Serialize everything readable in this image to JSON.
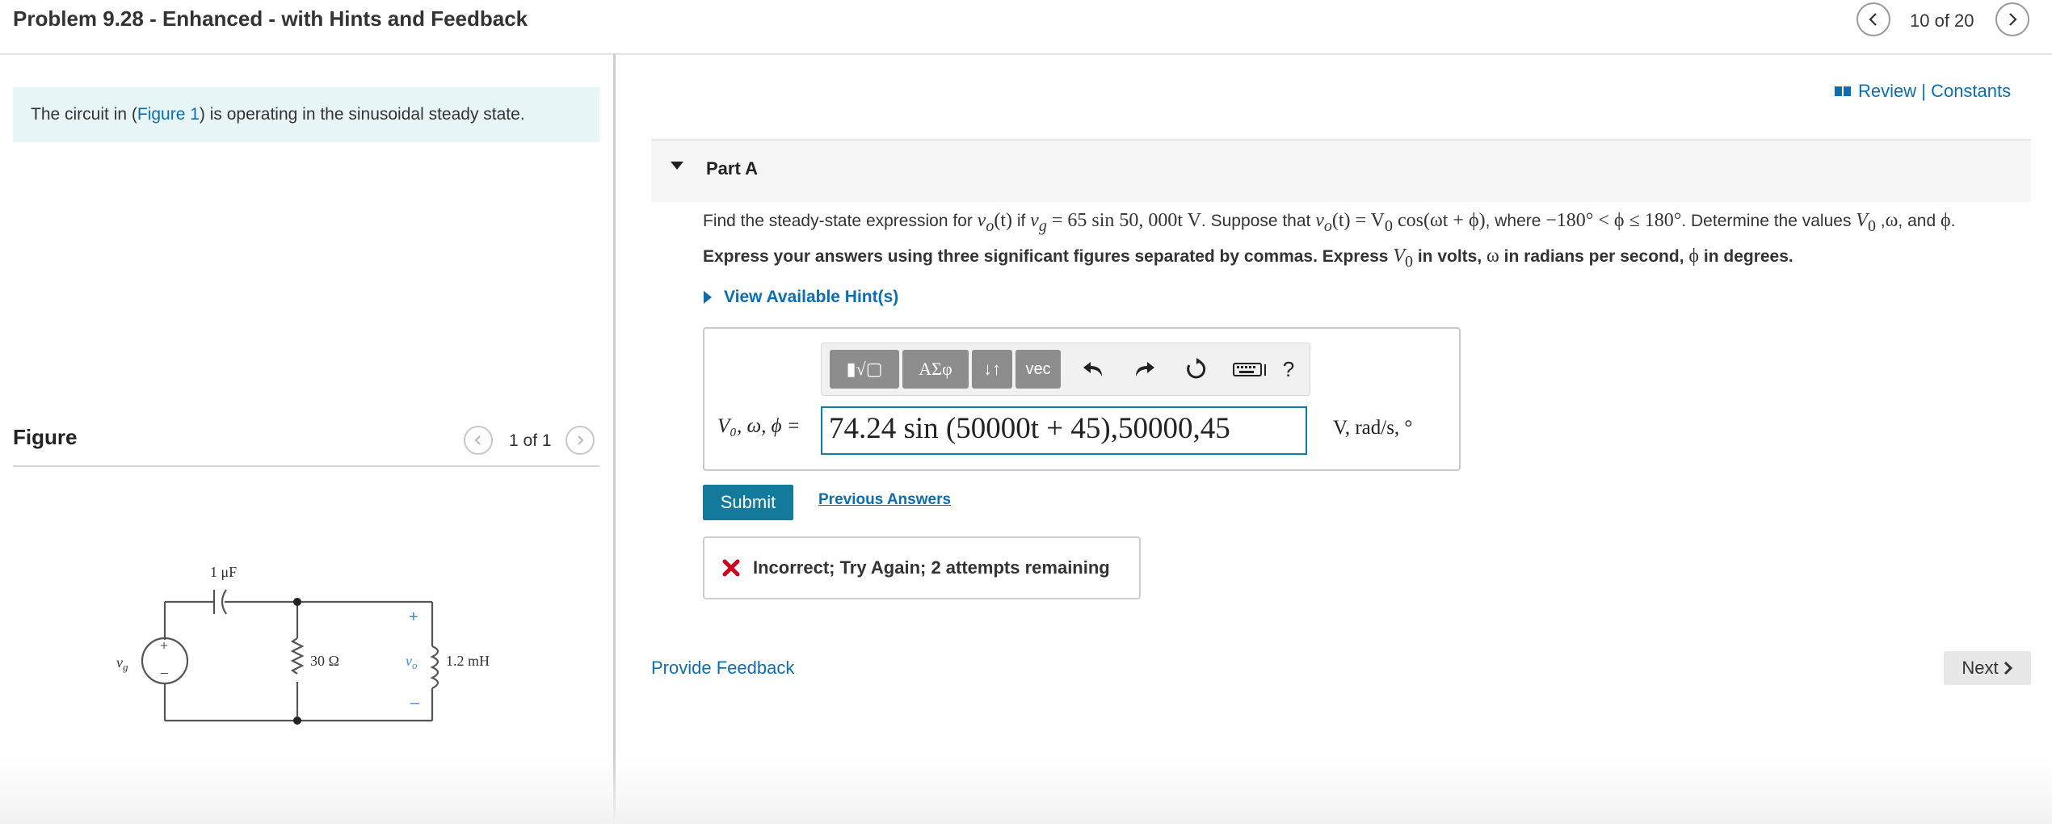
{
  "header": {
    "title": "Problem 9.28 - Enhanced - with Hints and Feedback",
    "counter": "10 of 20"
  },
  "intro": {
    "prefix": "The circuit in (",
    "figure_link": "Figure 1",
    "suffix": ") is operating in the sinusoidal steady state."
  },
  "figure": {
    "heading": "Figure",
    "counter": "1 of 1",
    "labels": {
      "capacitor": "1 μF",
      "resistor": "30 Ω",
      "inductor": "1.2 mH",
      "source": "v",
      "source_sub": "g",
      "vo": "v",
      "vo_sub": "o",
      "plus": "+",
      "minus": "–"
    }
  },
  "review": {
    "label": "Review | Constants"
  },
  "partA": {
    "title": "Part A",
    "question": {
      "t1": "Find the steady-state expression for ",
      "m1": "v",
      "m1sub": "o",
      "m1b": "(t)",
      "t2": " if ",
      "m2": "v",
      "m2sub": "g",
      "m2b": " = 65 sin 50, 000t V",
      "t3": ". Suppose that ",
      "m3": "v",
      "m3sub": "o",
      "m3b": "(t) = V",
      "m3sub2": "0",
      "m3c": " cos(ωt + ϕ)",
      "t4": ", where ",
      "m4": "−180° < ϕ ≤ 180°",
      "t5": ". Determine the values ",
      "m5": "V",
      "m5sub": "0",
      "t6": " ,",
      "m6": "ω",
      "t7": ", and ",
      "m7": "ϕ",
      "t8": "."
    },
    "instruction": {
      "t1": "Express your answers using three significant figures separated by commas. Express ",
      "m1": "V",
      "m1sub": "0",
      "t2": " in volts, ",
      "m2": "ω",
      "t3": " in radians per second, ",
      "m3": "ϕ",
      "t4": " in degrees."
    },
    "hint_label": "View Available Hint(s)",
    "toolbar": {
      "templates": "▮√▢",
      "greek": "ΑΣφ",
      "arrows": "↓↑",
      "vec": "vec",
      "help": "?"
    },
    "answer_label": "V₀, ω, ϕ =",
    "answer_value": "74.24 sin (50000t + 45),50000,45",
    "units": "V, rad/s, °",
    "submit_label": "Submit",
    "previous_answers": "Previous Answers",
    "feedback": "Incorrect; Try Again; 2 attempts remaining"
  },
  "footer": {
    "provide_feedback": "Provide Feedback",
    "next": "Next"
  },
  "colors": {
    "link": "#0b6eb0",
    "submit": "#137a9c",
    "error": "#d0021b",
    "intro_bg": "#e8f5f7"
  }
}
